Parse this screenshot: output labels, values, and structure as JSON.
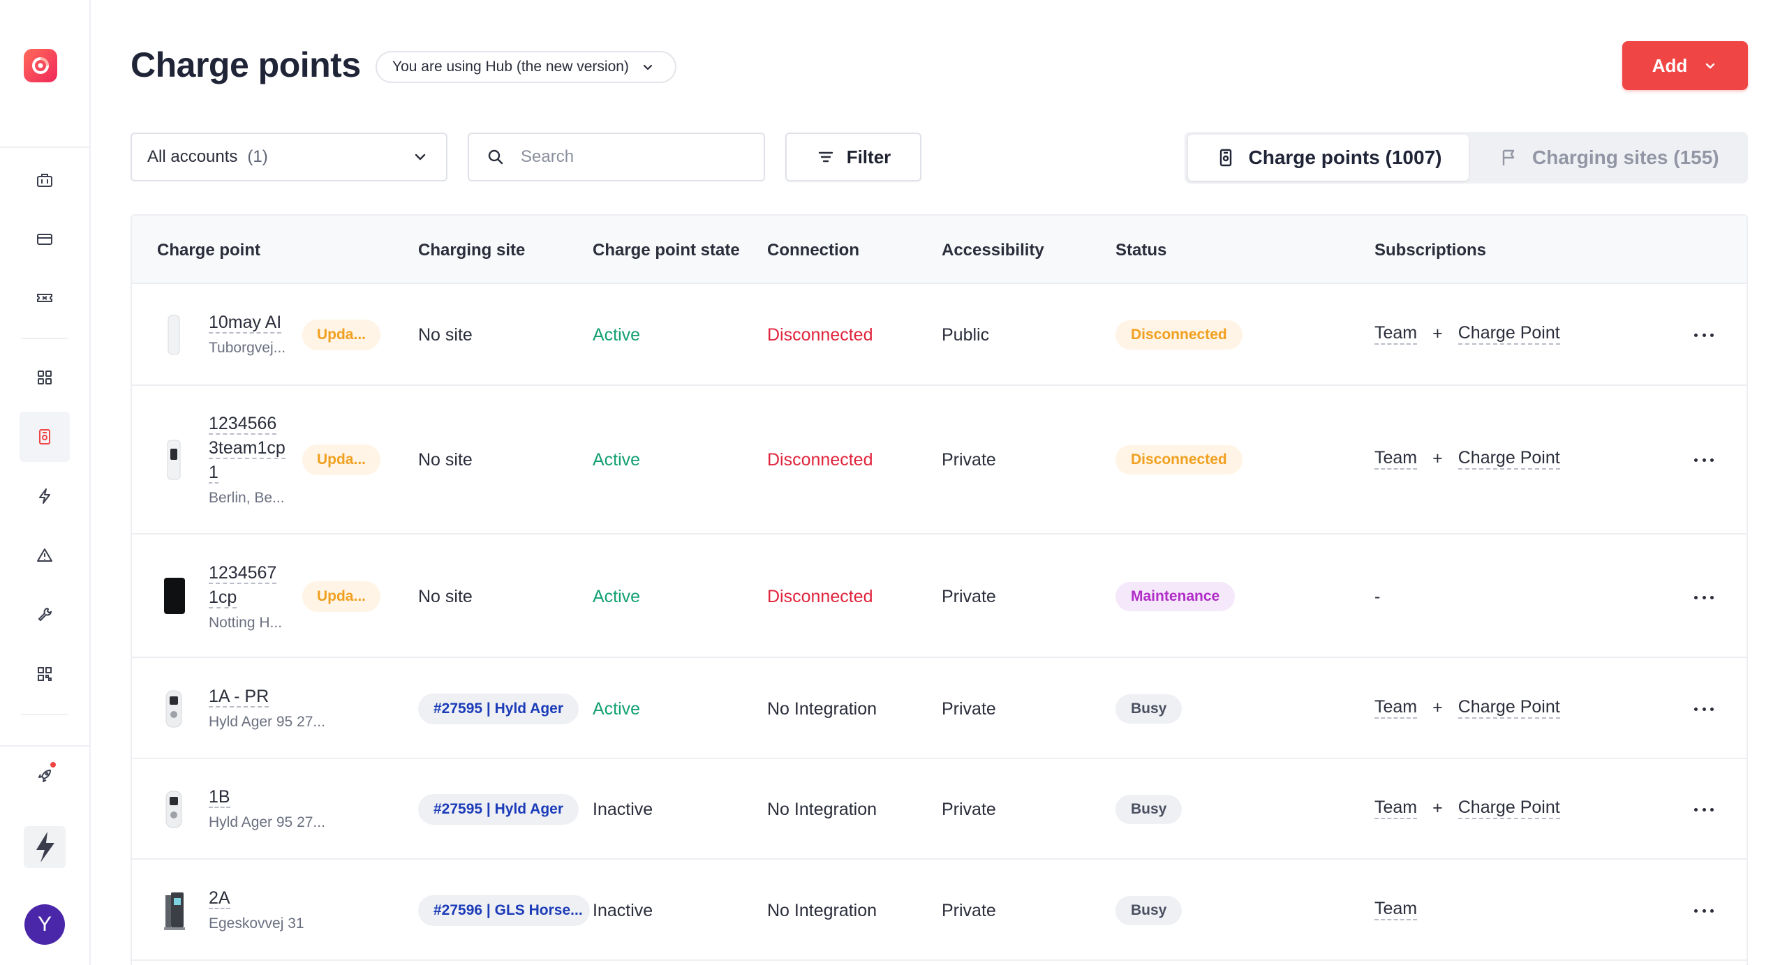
{
  "header": {
    "title": "Charge points",
    "version_label": "You are using Hub (the new version)",
    "add_label": "Add"
  },
  "toolbar": {
    "account_select": "All accounts",
    "account_count": "(1)",
    "search_placeholder": "Search",
    "filter_label": "Filter",
    "tab_charge_points": "Charge points (1007)",
    "tab_charging_sites": "Charging sites (155)"
  },
  "sidebar": {
    "avatar_initial": "Y",
    "items": [
      "briefcase-icon",
      "credit-card-icon",
      "ticket-icon",
      "grid-icon",
      "charge-point-icon",
      "lightning-icon",
      "alert-triangle-icon",
      "wrench-icon",
      "qr-code-icon",
      "rocket-icon"
    ]
  },
  "table": {
    "columns": [
      "Charge point",
      "Charging site",
      "Charge point state",
      "Connection",
      "Accessibility",
      "Status",
      "Subscriptions"
    ],
    "rows": [
      {
        "name_lines": [
          "10may AI"
        ],
        "address": "Tuborgvej...",
        "update_badge": "Upda...",
        "site": "No site",
        "state": "Active",
        "connection": "Disconnected",
        "accessibility": "Public",
        "status": "Disconnected",
        "sub1": "Team",
        "plus": "+",
        "sub2": "Charge Point"
      },
      {
        "name_lines": [
          "1234566",
          "3team1cp",
          "1"
        ],
        "address": "Berlin, Be...",
        "update_badge": "Upda...",
        "site": "No site",
        "state": "Active",
        "connection": "Disconnected",
        "accessibility": "Private",
        "status": "Disconnected",
        "sub1": "Team",
        "plus": "+",
        "sub2": "Charge Point"
      },
      {
        "name_lines": [
          "1234567",
          "1cp"
        ],
        "address": "Notting H...",
        "update_badge": "Upda...",
        "site": "No site",
        "state": "Active",
        "connection": "Disconnected",
        "accessibility": "Private",
        "status": "Maintenance",
        "sub1": "-"
      },
      {
        "name_lines": [
          "1A - PR"
        ],
        "address": "Hyld Ager 95 27...",
        "site": "#27595 | Hyld Ager",
        "state": "Active",
        "connection": "No Integration",
        "accessibility": "Private",
        "status": "Busy",
        "sub1": "Team",
        "plus": "+",
        "sub2": "Charge Point"
      },
      {
        "name_lines": [
          "1B"
        ],
        "address": "Hyld Ager 95 27...",
        "site": "#27595 | Hyld Ager",
        "state": "Inactive",
        "connection": "No Integration",
        "accessibility": "Private",
        "status": "Busy",
        "sub1": "Team",
        "plus": "+",
        "sub2": "Charge Point"
      },
      {
        "name_lines": [
          "2A"
        ],
        "address": "Egeskovvej 31",
        "site": "#27596 | GLS Horse...",
        "state": "Inactive",
        "connection": "No Integration",
        "accessibility": "Private",
        "status": "Busy",
        "sub1": "Team"
      }
    ]
  }
}
